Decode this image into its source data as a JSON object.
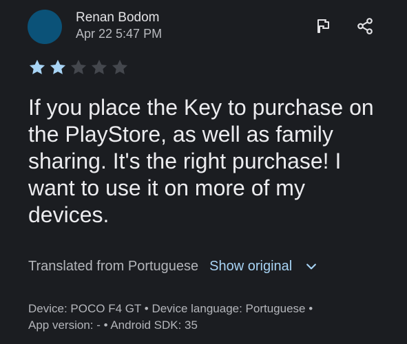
{
  "review": {
    "author": "Renan Bodom",
    "date": "Apr 22 5:47 PM",
    "rating": 2,
    "max_rating": 5,
    "text": "If you place the Key to purchase on the PlayStore, as well as family sharing. It's the right purchase! I want to use it on more of my devices.",
    "translated_note": "Translated from Portuguese",
    "show_original_label": "Show original",
    "device_line_1": "Device: POCO F4 GT • Device language: Portuguese •",
    "device_line_2": "App version: - • Android SDK: 35"
  },
  "icons": {
    "flag": "flag-icon",
    "share": "share-icon",
    "chevron": "chevron-down-icon",
    "star": "star-icon"
  },
  "colors": {
    "background": "#1b1d21",
    "avatar": "#0b5278",
    "star_filled": "#a8d4f5",
    "star_empty": "#44474d",
    "link": "#a8d4f5"
  }
}
